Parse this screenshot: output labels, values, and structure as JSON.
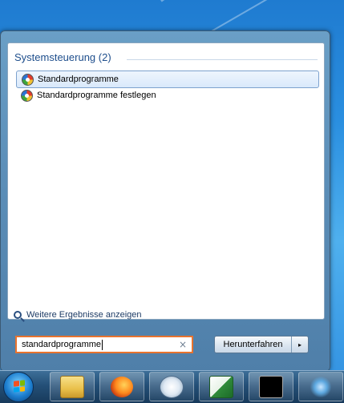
{
  "start_menu": {
    "section_title": "Systemsteuerung (2)",
    "results": [
      {
        "label": "Standardprogramme",
        "icon": "default-programs-icon",
        "selected": true
      },
      {
        "label": "Standardprogramme festlegen",
        "icon": "default-programs-icon",
        "selected": false
      }
    ],
    "more_results": "Weitere Ergebnisse anzeigen",
    "search": {
      "value": "standardprogramme",
      "clear_icon": "×"
    },
    "shutdown": {
      "label": "Herunterfahren",
      "arrow_icon": "▸"
    }
  },
  "taskbar": {
    "items": [
      "explorer-icon",
      "firefox-icon",
      "mail-icon",
      "excel-icon",
      "cmd-icon",
      "network-icon"
    ]
  }
}
